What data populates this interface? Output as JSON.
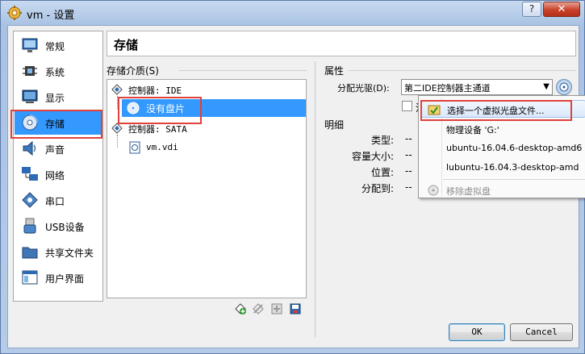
{
  "window": {
    "title": "vm - 设置",
    "help_label": "?",
    "close_label": "✕"
  },
  "categories": [
    {
      "label": "常规",
      "icon": "monitor-icon"
    },
    {
      "label": "系统",
      "icon": "chip-icon"
    },
    {
      "label": "显示",
      "icon": "display-icon"
    },
    {
      "label": "存储",
      "icon": "storage-disc-icon",
      "selected": true
    },
    {
      "label": "声音",
      "icon": "speaker-icon"
    },
    {
      "label": "网络",
      "icon": "network-icon"
    },
    {
      "label": "串口",
      "icon": "serial-port-icon"
    },
    {
      "label": "USB设备",
      "icon": "usb-icon"
    },
    {
      "label": "共享文件夹",
      "icon": "folder-icon"
    },
    {
      "label": "用户界面",
      "icon": "user-interface-icon"
    }
  ],
  "header": {
    "title": "存储"
  },
  "storage_media": {
    "label": "存储介质(S)",
    "tree": [
      {
        "label": "控制器: IDE",
        "type": "controller"
      },
      {
        "label": "没有盘片",
        "type": "optical",
        "selected": true
      },
      {
        "label": "控制器: SATA",
        "type": "controller"
      },
      {
        "label": "vm.vdi",
        "type": "disk"
      }
    ]
  },
  "attributes": {
    "label": "属性",
    "drive_label": "分配光驱(D):",
    "drive_value": "第二IDE控制器主通道",
    "checkbox_prefix": "活"
  },
  "details": {
    "label": "明细",
    "rows": [
      {
        "key": "类型:",
        "value": "--"
      },
      {
        "key": "容量大小:",
        "value": "--"
      },
      {
        "key": "位置:",
        "value": "--"
      },
      {
        "key": "分配到:",
        "value": "--"
      }
    ]
  },
  "menu": {
    "items": [
      {
        "label": "选择一个虚拟光盘文件...",
        "highlight": true
      },
      {
        "label": "物理设备 'G:'"
      },
      {
        "label": "ubuntu-16.04.6-desktop-amd6"
      },
      {
        "label": "lubuntu-16.04.3-desktop-amd"
      },
      {
        "label": "移除虚拟盘",
        "disabled": true
      }
    ]
  },
  "buttons": {
    "ok": "OK",
    "cancel": "Cancel"
  },
  "colors": {
    "selection": "#3399ff",
    "annotation_red": "#e0413a"
  }
}
